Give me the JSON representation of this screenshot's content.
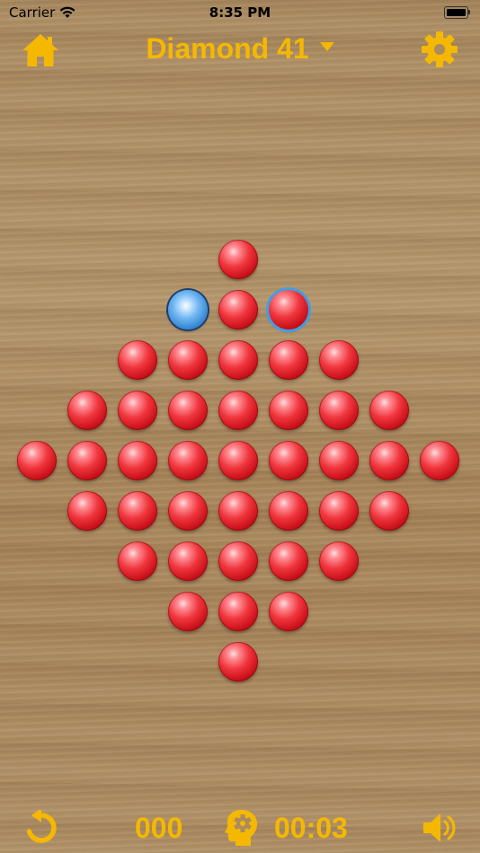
{
  "status_bar": {
    "carrier": "Carrier",
    "time": "8:35 PM"
  },
  "header": {
    "title": "Diamond 41",
    "home_icon": "home-icon",
    "dropdown_icon": "caret-down-icon",
    "settings_icon": "gear-icon"
  },
  "board": {
    "rows": [
      "....P....",
      "...OPS...",
      "..PPPPP..",
      ".PPPPPPP.",
      "PPPPPPPPP",
      ".PPPPPPP.",
      "..PPPPP..",
      "...PPP...",
      "....P...."
    ],
    "legend": {
      "P": "peg",
      "S": "selected-peg",
      "O": "empty-hole"
    },
    "peg_color": "#e3232c",
    "hole_color": "#4a9be6",
    "selection_color": "#3aa0e8"
  },
  "footer": {
    "undo_icon": "undo-icon",
    "moves": "000",
    "hint_icon": "brain-gear-icon",
    "timer": "00:03",
    "sound_icon": "speaker-icon"
  },
  "colors": {
    "accent": "#f5b800",
    "wood": "#ab8b61"
  }
}
